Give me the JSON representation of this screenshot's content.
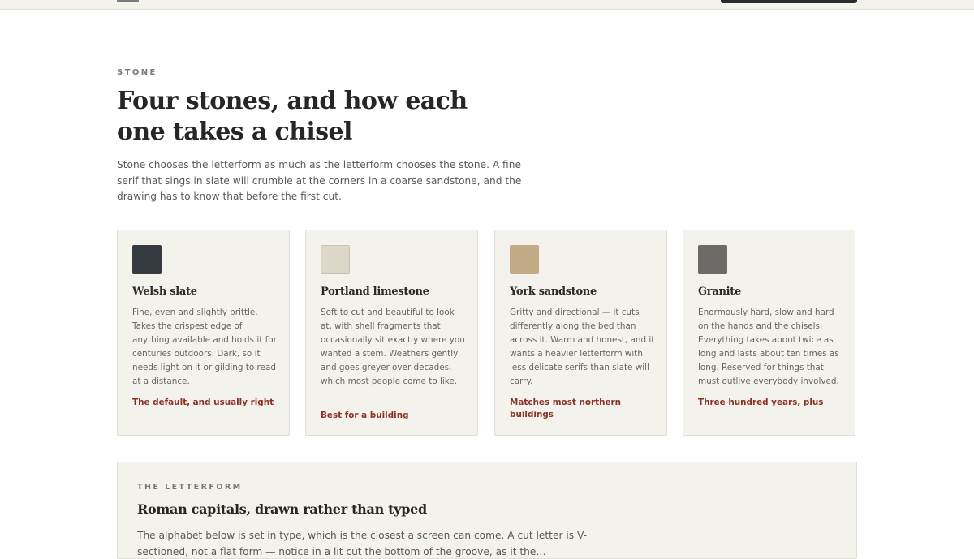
{
  "section": {
    "eyebrow": "STONE",
    "title": "Four stones, and how each one takes a chisel",
    "intro": "Stone chooses the letterform as much as the letterform chooses the stone. A fine serif that sings in slate will crumble at the corners in a coarse sandstone, and the drawing has to know that before the first cut."
  },
  "stones": [
    {
      "name": "Welsh slate",
      "swatch_color": "#343a40",
      "description": "Fine, even and slightly brittle. Takes the crispest edge of anything available and holds it for centuries outdoors. Dark, so it needs light on it or gilding to read at a distance.",
      "note": "The default, and usually right"
    },
    {
      "name": "Portland limestone",
      "swatch_color": "#dcd7c7",
      "description": "Soft to cut and beautiful to look at, with shell fragments that occasionally sit exactly where you wanted a stem. Weathers gently and goes greyer over decades, which most people come to like.",
      "note": "Best for a building"
    },
    {
      "name": "York sandstone",
      "swatch_color": "#c2ab86",
      "description": "Gritty and directional — it cuts differently along the bed than across it. Warm and honest, and it wants a heavier letterform with less delicate serifs than slate will carry.",
      "note": "Matches most northern buildings"
    },
    {
      "name": "Granite",
      "swatch_color": "#6e6a67",
      "description": "Enormously hard, slow and hard on the hands and the chisels. Everything takes about twice as long and lasts about ten times as long. Reserved for things that must outlive everybody involved.",
      "note": "Three hundred years, plus"
    }
  ],
  "letterform": {
    "eyebrow": "THE LETTERFORM",
    "title": "Roman capitals, drawn rather than typed",
    "body": "The alphabet below is set in type, which is the closest a screen can come. A cut letter is V-sectioned, not a flat form — notice in a lit cut the bottom of the groove, as it the…"
  },
  "colors": {
    "accent_note": "#8a3226",
    "card_bg": "#f4f2ec"
  }
}
